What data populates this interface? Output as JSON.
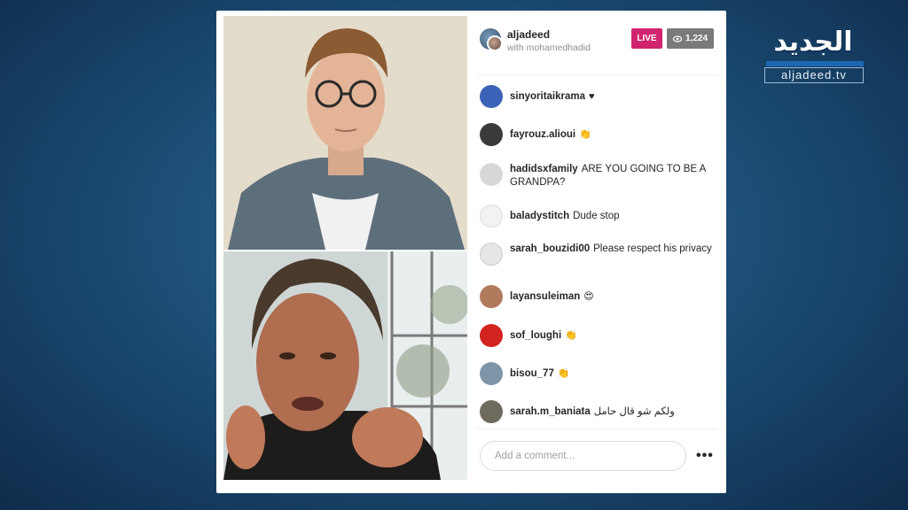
{
  "header": {
    "username": "aljadeed",
    "with_text": "with mohamedhadid",
    "live_badge": "LIVE",
    "viewer_count": "1,224",
    "viewer_icon": "eye-icon"
  },
  "comments": [
    {
      "user": "sinyoritaikrama",
      "text": "",
      "emoji": "♥",
      "avatar_color": "#3b62b8"
    },
    {
      "user": "fayrouz.alioui",
      "text": "",
      "emoji": "👏",
      "avatar_color": "#3a3a3a"
    },
    {
      "user": "hadidsxfamily",
      "text": "ARE YOU GOING TO BE A GRANDPA?",
      "emoji": "",
      "avatar_color": "#d8d8d8"
    },
    {
      "user": "baladystitch",
      "text": "Dude stop",
      "emoji": "",
      "avatar_color": "#f2f2f2"
    },
    {
      "user": "sarah_bouzidi00",
      "text": "Please respect his privacy",
      "emoji": "",
      "avatar_color": "#e6e6e6"
    },
    {
      "user": "layansuleiman",
      "text": "",
      "emoji": "😍",
      "avatar_color": "#b07a5c"
    },
    {
      "user": "sof_loughi",
      "text": "",
      "emoji": "👏",
      "avatar_color": "#d3241f"
    },
    {
      "user": "bisou_77",
      "text": "",
      "emoji": "👏",
      "avatar_color": "#7e95a8"
    },
    {
      "user": "sarah.m_baniata",
      "text": "ولكم شو قال حامل",
      "emoji": "",
      "avatar_color": "#6f6a5e"
    }
  ],
  "comment_input": {
    "placeholder": "Add a comment..."
  },
  "more_options": "•••",
  "logo": {
    "arabic": "الجديد",
    "url_text": "aljadeed.tv"
  },
  "colors": {
    "live_badge": "#d1246e",
    "viewer_badge": "#7a7a7a",
    "background": "#1d4f78"
  }
}
